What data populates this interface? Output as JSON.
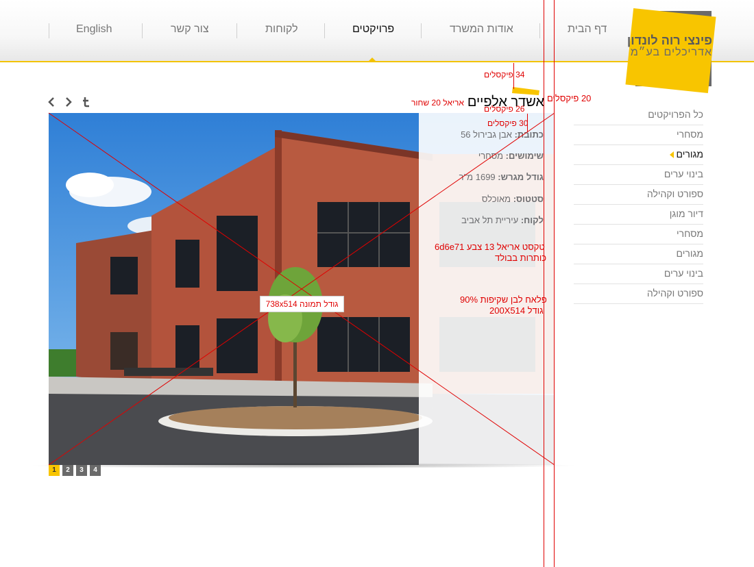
{
  "nav": {
    "items": [
      {
        "label": "דף הבית",
        "active": false
      },
      {
        "label": "אודות המשרד",
        "active": false
      },
      {
        "label": "פרויקטים",
        "active": true
      },
      {
        "label": "לקוחות",
        "active": false
      },
      {
        "label": "צור קשר",
        "active": false
      },
      {
        "label": "English",
        "active": false
      }
    ]
  },
  "logo": {
    "line1": "פינצי רוה לונדון",
    "line2": "אדריכלים בע״מ"
  },
  "project": {
    "title": "אשדר אלפיים",
    "info": [
      {
        "label": "כתובת:",
        "value": "אבן גבירול 56"
      },
      {
        "label": "שימושים:",
        "value": "מסחרי"
      },
      {
        "label": "גודל מגרש:",
        "value": "1699 מ\"ר"
      },
      {
        "label": "סטטוס:",
        "value": "מאוכלס"
      },
      {
        "label": "לקוח:",
        "value": "עיריית תל אביב"
      }
    ]
  },
  "toolbar": {
    "prev_icon": "chevron-left-icon",
    "next_icon": "chevron-right-icon",
    "share_icon": "tumblr-icon"
  },
  "pagination": {
    "pages": [
      "1",
      "2",
      "3",
      "4"
    ],
    "active": "1"
  },
  "sidebar": {
    "items": [
      {
        "label": "כל הפרויקטים",
        "active": false
      },
      {
        "label": "מסחרי",
        "active": false
      },
      {
        "label": "מגורים",
        "active": true
      },
      {
        "label": "בינוי ערים",
        "active": false
      },
      {
        "label": "ספורט וקהילה",
        "active": false
      },
      {
        "label": "דיור מוגן",
        "active": false
      },
      {
        "label": "מסחרי",
        "active": false
      },
      {
        "label": "מגורים",
        "active": false
      },
      {
        "label": "בינוי ערים",
        "active": false
      },
      {
        "label": "ספורט וקהילה",
        "active": false
      }
    ]
  },
  "annotations": {
    "px34": "34 פיקסלים",
    "px20": "20 פיקסלים",
    "px26": "26 פיקסלים",
    "px30": "30 פיקסלים",
    "title_font": "אריאל 20 שחור",
    "text_style_1": "טקסט אריאל 13 צבע 6d6e71",
    "text_style_2": "כותרות בבולד",
    "panel_1": "פלאח לבן שקיפות 90%",
    "panel_2": "גודל 200X514",
    "image_size": "גודל תמונה 738x514"
  },
  "colors": {
    "accent": "#f8c500",
    "text_grey": "#6d6e71",
    "annotation": "#e00000"
  }
}
